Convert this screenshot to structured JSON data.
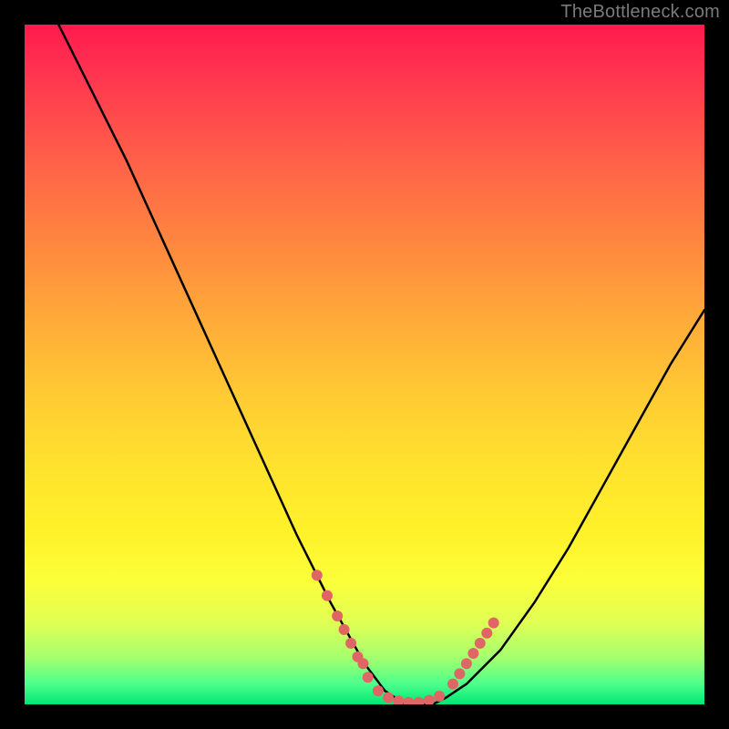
{
  "watermark": "TheBottleneck.com",
  "colors": {
    "frame": "#000000",
    "gradient_top": "#ff1a4d",
    "gradient_bottom": "#00e676",
    "curve": "#000000",
    "markers": "#e06666"
  },
  "chart_data": {
    "type": "line",
    "title": "",
    "xlabel": "",
    "ylabel": "",
    "xlim": [
      0,
      100
    ],
    "ylim": [
      0,
      100
    ],
    "grid": false,
    "legend": false,
    "series": [
      {
        "name": "curve",
        "x": [
          0,
          5,
          10,
          15,
          20,
          25,
          30,
          35,
          40,
          45,
          50,
          53,
          56,
          58,
          60,
          62,
          65,
          70,
          75,
          80,
          85,
          90,
          95,
          100
        ],
        "y": [
          110,
          100,
          90,
          80,
          69,
          58,
          47,
          36,
          25,
          15,
          6,
          2,
          0,
          0,
          0,
          1,
          3,
          8,
          15,
          23,
          32,
          41,
          50,
          58
        ]
      },
      {
        "name": "markers-left",
        "x": [
          43,
          44.5,
          46,
          47,
          48,
          49,
          49.8
        ],
        "y": [
          19,
          16,
          13,
          11,
          9,
          7,
          6
        ]
      },
      {
        "name": "markers-bottom",
        "x": [
          50.5,
          52,
          53.5,
          55,
          56.5,
          58,
          59.5,
          61
        ],
        "y": [
          4,
          2,
          1,
          0.5,
          0.3,
          0.3,
          0.6,
          1.2
        ]
      },
      {
        "name": "markers-right",
        "x": [
          63,
          64,
          65,
          66,
          67,
          68,
          69
        ],
        "y": [
          3,
          4.5,
          6,
          7.5,
          9,
          10.5,
          12
        ]
      }
    ]
  }
}
